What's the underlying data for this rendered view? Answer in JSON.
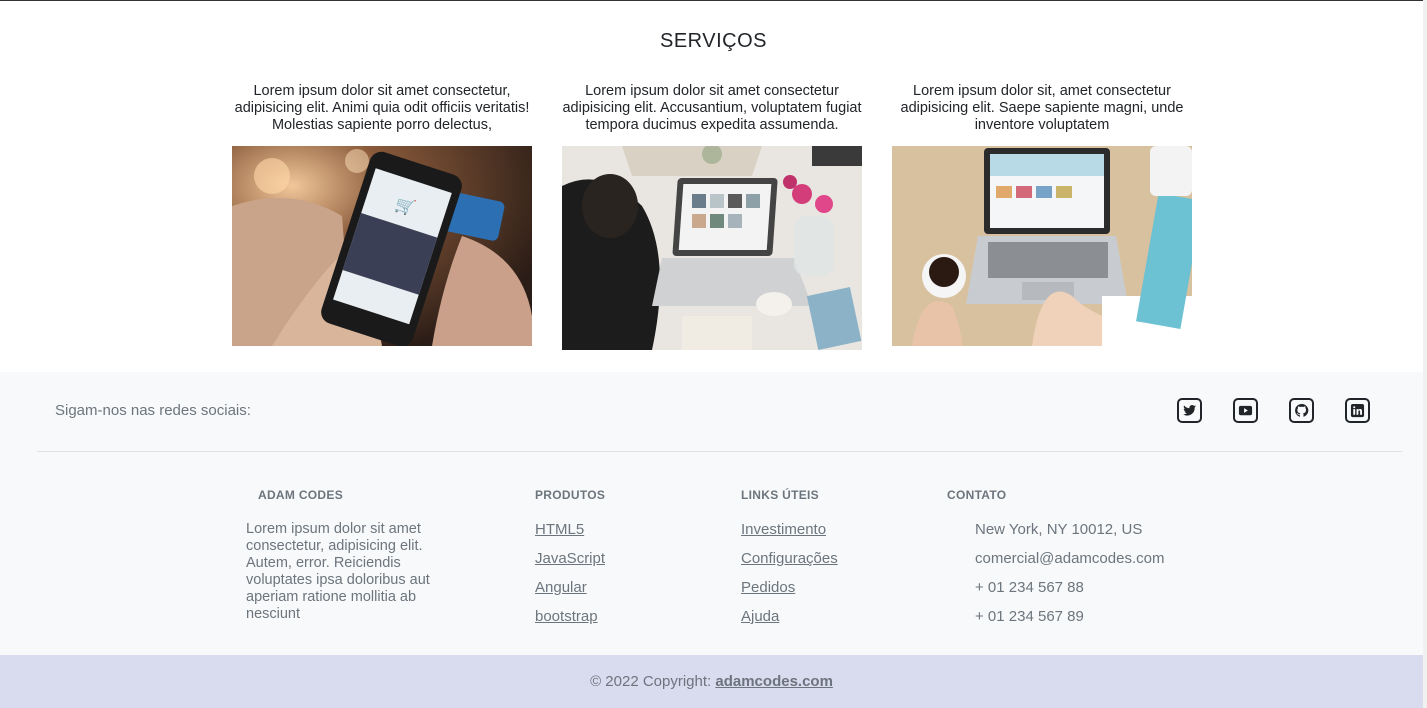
{
  "services": {
    "title": "SERVIÇOS",
    "cards": [
      {
        "text": "Lorem ipsum dolor sit amet consectetur, adipisicing elit. Animi quia odit officiis veritatis! Molestias sapiente porro delectus,"
      },
      {
        "text": "Lorem ipsum dolor sit amet consectetur adipisicing elit. Accusantium, voluptatem fugiat tempora ducimus expedita assumenda."
      },
      {
        "text": "Lorem ipsum dolor sit, amet consectetur adipisicing elit. Saepe sapiente magni, unde inventore voluptatem"
      }
    ]
  },
  "social": {
    "label": "Sigam-nos nas redes sociais:",
    "icons": [
      "twitter-icon",
      "youtube-icon",
      "github-icon",
      "linkedin-icon"
    ]
  },
  "footer": {
    "about": {
      "title": "ADAM CODES",
      "text": "Lorem ipsum dolor sit amet consectetur, adipisicing elit. Autem, error. Reiciendis voluptates ipsa doloribus aut aperiam ratione mollitia ab nesciunt"
    },
    "products": {
      "title": "PRODUTOS",
      "links": [
        "HTML5",
        "JavaScript",
        "Angular",
        "bootstrap"
      ]
    },
    "useful": {
      "title": "LINKS ÚTEIS",
      "links": [
        "Investimento",
        "Configurações",
        "Pedidos",
        "Ajuda"
      ]
    },
    "contact": {
      "title": "CONTATO",
      "items": [
        "New York, NY 10012, US",
        "comercial@adamcodes.com",
        "+ 01 234 567 88",
        "+ 01 234 567 89"
      ]
    }
  },
  "copyright": {
    "prefix": "© 2022 Copyright: ",
    "link": "adamcodes.com"
  },
  "colors": {
    "footer_bg": "#f8f9fa",
    "copyright_bg": "#d9dbee",
    "muted_text": "#6c757d"
  }
}
